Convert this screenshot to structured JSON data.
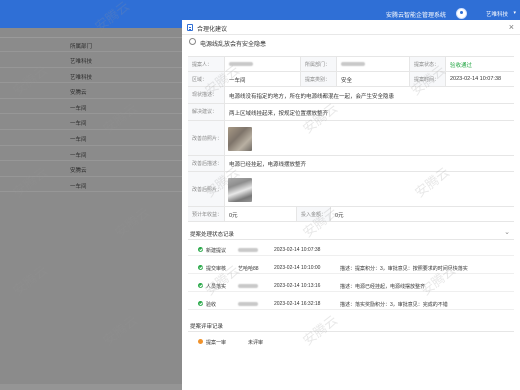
{
  "topbar": {
    "system_title": "安腾云智能企管理系统",
    "company": "艺唯科技",
    "caret": "▾"
  },
  "left": {
    "column_header": "所属部门",
    "rows": [
      "艺唯科技",
      "艺唯科技",
      "安腾云",
      "一车间",
      "一车间",
      "一车间",
      "一车间",
      "安腾云",
      "一车间"
    ]
  },
  "drawer": {
    "title": "合理化建议",
    "close": "×",
    "subject": "电源线乱放会有安全隐患",
    "fields": {
      "proposer_label": "提案人：",
      "dept_label": "所属部门：",
      "status_label": "提案状态：",
      "status_value": "验收通过",
      "area_label": "区域：",
      "area_value": "一车间",
      "category_label": "提案类别：",
      "category_value": "安全",
      "time_label": "提案时间：",
      "time_value": "2023-02-14 10:07:38"
    },
    "current_label": "现状描述：",
    "current_value": "电源线没有指定的地方，所在的电源线都混在一起，会产生安全隐患",
    "suggest_label": "解决建议：",
    "suggest_value": "两上区域线挂起来，按规定位置摆放整齐",
    "before_label": "改善前照片：",
    "after_desc_label": "改善后描述：",
    "after_desc_value": "电源已经挂起，电源线摆放整齐",
    "after_photo_label": "改善后照片：",
    "expected_label": "预计年收益：",
    "expected_value": "0元",
    "invest_label": "投入金额：",
    "invest_value": "0元"
  },
  "records": {
    "section_title": "提案处理状态记录",
    "chevron": "⌄",
    "items": [
      {
        "step": "新建提议",
        "who": "",
        "time": "2023-02-14 10:07:38",
        "msg": ""
      },
      {
        "step": "提交审核",
        "who": "艺哈哈88",
        "time": "2023-02-14 10:10:00",
        "msg": "描述：提案积分：3，审批意见：按照要求的时间尽快落实"
      },
      {
        "step": "人员落实",
        "who": "",
        "time": "2023-02-14 10:13:16",
        "msg": "描述：电源已经挂起，电源线摆放整齐"
      },
      {
        "step": "验收",
        "who": "",
        "time": "2023-02-14 16:32:18",
        "msg": "描述：落实奖励积分：3，审批意见：完成的不错"
      }
    ]
  },
  "evaluation": {
    "section_title": "提案评审记录",
    "step": "提案一审",
    "value": "未评审"
  },
  "watermark": "安腾云",
  "colors": {
    "primary": "#2f6fd6",
    "success": "#27a847",
    "warning": "#f0922b",
    "overlay": "#8b8b8b"
  }
}
